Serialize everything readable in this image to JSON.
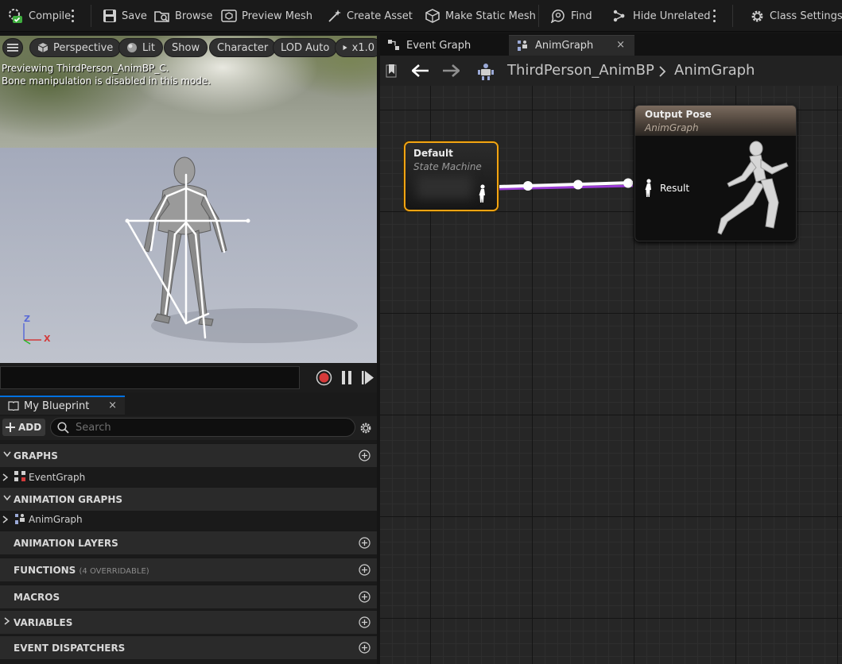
{
  "toolbar": {
    "compile": "Compile",
    "save": "Save",
    "browse": "Browse",
    "preview_mesh": "Preview Mesh",
    "create_asset": "Create Asset",
    "make_static_mesh": "Make Static Mesh",
    "find": "Find",
    "hide_unrelated": "Hide Unrelated",
    "class_settings": "Class Settings"
  },
  "viewport": {
    "perspective": "Perspective",
    "lit": "Lit",
    "show": "Show",
    "character": "Character",
    "lod": "LOD Auto",
    "speed": "x1.0",
    "message_line1": "Previewing ThirdPerson_AnimBP_C.",
    "message_line2": "Bone manipulation is disabled in this mode.",
    "axis_z": "Z",
    "axis_x": "X"
  },
  "my_blueprint": {
    "tab_label": "My Blueprint",
    "tab_close": "×",
    "add_label": "ADD",
    "search_placeholder": "Search",
    "sections": {
      "graphs": "GRAPHS",
      "animation_graphs": "ANIMATION GRAPHS",
      "animation_layers": "ANIMATION LAYERS",
      "functions": "FUNCTIONS",
      "functions_sub": "(4 OVERRIDABLE)",
      "macros": "MACROS",
      "variables": "VARIABLES",
      "event_dispatchers": "EVENT DISPATCHERS"
    },
    "items": {
      "event_graph": "EventGraph",
      "anim_graph": "AnimGraph"
    }
  },
  "graph": {
    "tabs": [
      "Event Graph",
      "AnimGraph"
    ],
    "tab_close": "×",
    "breadcrumb": [
      "ThirdPerson_AnimBP",
      "AnimGraph"
    ],
    "nodes": {
      "state_machine_title": "Default",
      "state_machine_subtitle": "State Machine",
      "output_title": "Output Pose",
      "output_subtitle": "AnimGraph",
      "output_pin": "Result"
    }
  },
  "colors": {
    "accent_blue": "#0070e0",
    "node_selected": "#f2a413",
    "exec_wire": "#ffffff",
    "pose_wire": "#9b3bd6",
    "record_red": "#d63a3a"
  }
}
